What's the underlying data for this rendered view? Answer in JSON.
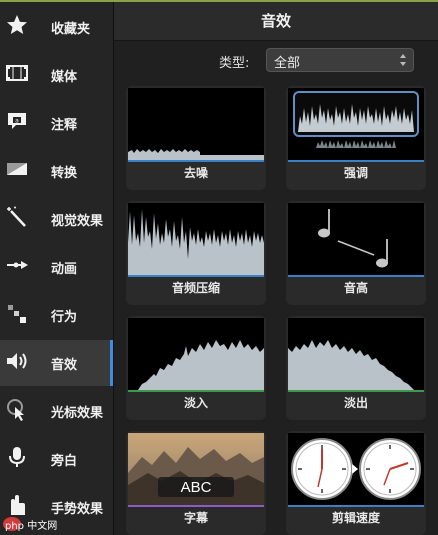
{
  "sidebar": {
    "items": [
      {
        "label": "收藏夹",
        "icon": "star-icon"
      },
      {
        "label": "媒体",
        "icon": "film-icon"
      },
      {
        "label": "注释",
        "icon": "annotation-icon"
      },
      {
        "label": "转换",
        "icon": "transition-icon"
      },
      {
        "label": "视觉效果",
        "icon": "magic-wand-icon"
      },
      {
        "label": "动画",
        "icon": "animation-arrow-icon"
      },
      {
        "label": "行为",
        "icon": "behavior-icon"
      },
      {
        "label": "音效",
        "icon": "speaker-icon",
        "active": true
      },
      {
        "label": "光标效果",
        "icon": "cursor-icon"
      },
      {
        "label": "旁白",
        "icon": "microphone-icon"
      },
      {
        "label": "手势效果",
        "icon": "gesture-icon"
      }
    ]
  },
  "panel": {
    "title": "音效",
    "filter_label": "类型:",
    "filter_value": "全部"
  },
  "effects": {
    "items": [
      {
        "label": "去噪",
        "underline_color": "#3b7fc4"
      },
      {
        "label": "强调",
        "underline_color": "#3b7fc4",
        "selected": true
      },
      {
        "label": "音频压缩",
        "underline_color": "#3b7fc4"
      },
      {
        "label": "音高",
        "underline_color": "#3b7fc4"
      },
      {
        "label": "淡入",
        "underline_color": "#3c9a4a"
      },
      {
        "label": "淡出",
        "underline_color": "#3c9a4a"
      },
      {
        "label": "字幕",
        "underline_color": "#8a5cc8",
        "caption_text": "ABC"
      },
      {
        "label": "剪辑速度",
        "underline_color": "#3b7fc4"
      }
    ]
  },
  "watermark": {
    "text": "php 中文网"
  },
  "colors": {
    "accent": "#3b8ee0",
    "top_line": "#8aa04a"
  }
}
